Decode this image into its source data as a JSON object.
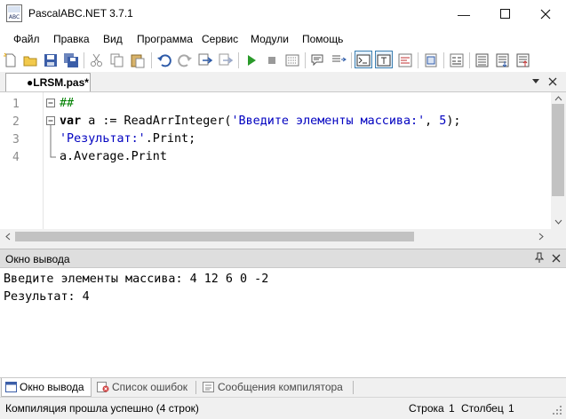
{
  "window": {
    "title": "PascalABC.NET 3.7.1",
    "logo_text": "ABC"
  },
  "menu": [
    "Файл",
    "Правка",
    "Вид",
    "Программа",
    "Сервис",
    "Модули",
    "Помощь"
  ],
  "toolbar_icons": [
    "new-file-icon",
    "open-folder-icon",
    "save-icon",
    "save-all-icon",
    "cut-icon",
    "copy-icon",
    "paste-icon",
    "undo-icon",
    "redo-icon",
    "find-icon",
    "replace-icon",
    "run-icon",
    "stop-icon",
    "debug-icon",
    "comment-icon",
    "uncomment-icon",
    "console-icon",
    "text-icon",
    "format-icon",
    "properties-icon",
    "code-icon",
    "watch-icon",
    "step-into-icon",
    "step-out-icon"
  ],
  "editor": {
    "tab_label": "●LRSM.pas*",
    "line_numbers": [
      "1",
      "2",
      "3",
      "4"
    ],
    "lines": {
      "l1_comment": "##",
      "l2_kw": "var",
      "l2_a": " a := ReadArrInteger(",
      "l2_str": "'Введите элементы массива:'",
      "l2_comma": ", ",
      "l2_num": "5",
      "l2_end": ");",
      "l3_str": "'Результат:'",
      "l3_rest": ".Print;",
      "l4": "a.Average.Print"
    }
  },
  "output": {
    "title": "Окно вывода",
    "lines": [
      "Введите элементы массива: 4 12 6 0 -2",
      "Результат: 4"
    ]
  },
  "bottom_tabs": [
    "Окно вывода",
    "Список ошибок",
    "Сообщения компилятора"
  ],
  "status": {
    "message": "Компиляция прошла успешно (4 строк)",
    "row_label": "Строка",
    "row_value": "1",
    "col_label": "Столбец",
    "col_value": "1"
  },
  "colors": {
    "string": "#0000c0",
    "comment": "#008000",
    "run": "#2a9a2a"
  }
}
